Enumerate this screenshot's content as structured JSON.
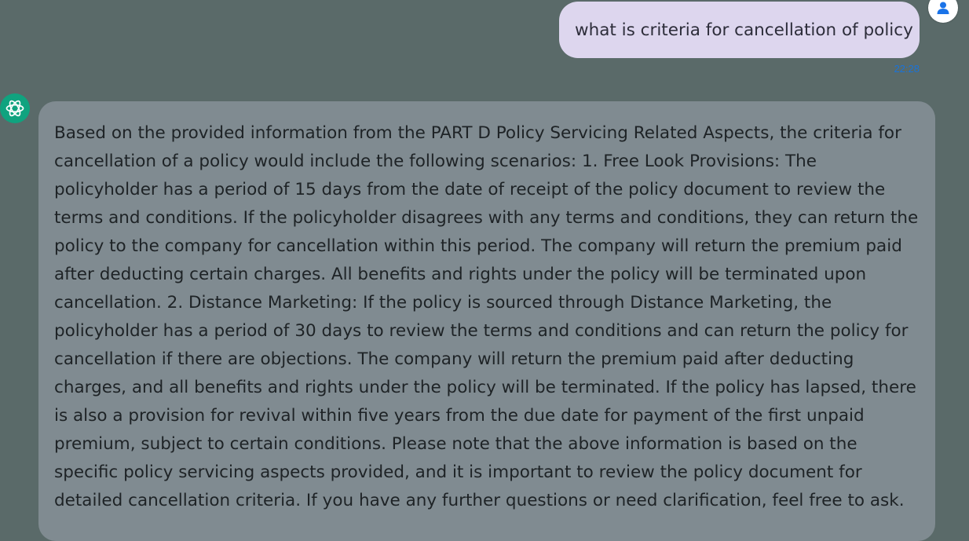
{
  "user_message": {
    "text": "what is criteria for cancellation of policy",
    "time": "22:28"
  },
  "bot_message": {
    "text": "Based on the provided information from the PART D Policy Servicing Related Aspects, the criteria for cancellation of a policy would include the following scenarios: 1. Free Look Provisions: The policyholder has a period of 15 days from the date of receipt of the policy document to review the terms and conditions. If the policyholder disagrees with any terms and conditions, they can return the policy to the company for cancellation within this period. The company will return the premium paid after deducting certain charges. All benefits and rights under the policy will be terminated upon cancellation. 2. Distance Marketing: If the policy is sourced through Distance Marketing, the policyholder has a period of 30 days to review the terms and conditions and can return the policy for cancellation if there are objections. The company will return the premium paid after deducting charges, and all benefits and rights under the policy will be terminated. If the policy has lapsed, there is also a provision for revival within five years from the due date for payment of the first unpaid premium, subject to certain conditions. Please note that the above information is based on the specific policy servicing aspects provided, and it is important to review the policy document for detailed cancellation criteria. If you have any further questions or need clarification, feel free to ask."
  },
  "icons": {
    "user_avatar": "person-icon",
    "bot_avatar": "openai-logo-icon"
  },
  "colors": {
    "background": "#5a6a69",
    "user_bubble": "#ddd6ee",
    "bot_bubble": "#808b91",
    "timestamp": "#1a73d9",
    "bot_avatar": "#10a37f",
    "user_icon": "#1a73e8"
  }
}
